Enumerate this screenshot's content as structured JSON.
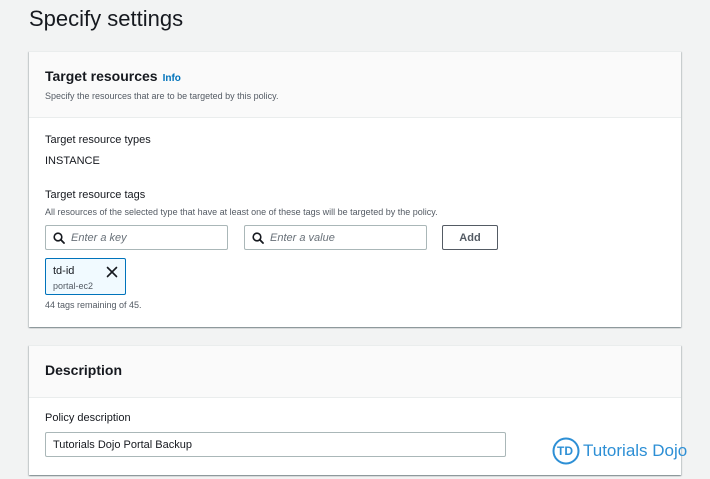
{
  "page": {
    "title": "Specify settings"
  },
  "target_resources": {
    "heading": "Target resources",
    "info_link": "Info",
    "description": "Specify the resources that are to be targeted by this policy.",
    "resource_types_label": "Target resource types",
    "resource_types_value": "INSTANCE",
    "tags_label": "Target resource tags",
    "tags_description": "All resources of the selected type that have at least one of these tags will be targeted by the policy.",
    "key_placeholder": "Enter a key",
    "value_placeholder": "Enter a value",
    "add_label": "Add",
    "tags": [
      {
        "key": "td-id",
        "value": "portal-ec2"
      }
    ],
    "tags_remaining": "44 tags remaining of 45."
  },
  "description_panel": {
    "heading": "Description",
    "policy_description_label": "Policy description",
    "policy_description_value": "Tutorials Dojo Portal Backup"
  },
  "watermark": {
    "logo_letters": "TD",
    "text": "Tutorials Dojo",
    "color": "#2d8fd5"
  },
  "colors": {
    "link": "#0073bb",
    "token_bg": "#f1faff",
    "token_border": "#0073bb"
  },
  "icons": {
    "search": "search-icon",
    "remove": "close-icon"
  }
}
